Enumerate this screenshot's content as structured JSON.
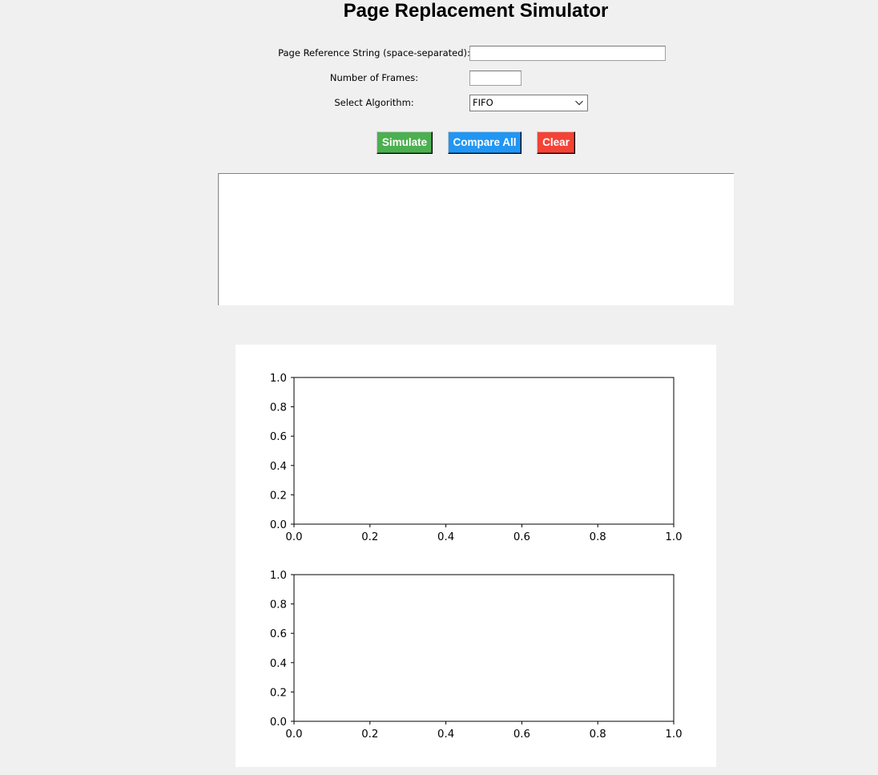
{
  "header": {
    "title": "Page Replacement Simulator"
  },
  "form": {
    "reference_label": "Page Reference String (space-separated):",
    "reference_value": "",
    "frames_label": "Number of Frames:",
    "frames_value": "",
    "algorithm_label": "Select Algorithm:",
    "algorithm_selected": "FIFO"
  },
  "buttons": {
    "simulate": {
      "label": "Simulate",
      "color": "#4caf50"
    },
    "compare": {
      "label": "Compare All",
      "color": "#2196f3"
    },
    "clear": {
      "label": "Clear",
      "color": "#f44336"
    }
  },
  "output": {
    "text": ""
  },
  "icons": {
    "combo_arrow": "chevron-down-icon"
  },
  "chart_data": [
    {
      "type": "line",
      "series": [],
      "title": "",
      "xlabel": "",
      "ylabel": "",
      "xlim": [
        0,
        1
      ],
      "ylim": [
        0,
        1
      ],
      "x_ticks": [
        0.0,
        0.2,
        0.4,
        0.6,
        0.8,
        1.0
      ],
      "y_ticks": [
        0.0,
        0.2,
        0.4,
        0.6,
        0.8,
        1.0
      ],
      "x_tick_labels": [
        "0.0",
        "0.2",
        "0.4",
        "0.6",
        "0.8",
        "1.0"
      ],
      "y_tick_labels": [
        "0.0",
        "0.2",
        "0.4",
        "0.6",
        "0.8",
        "1.0"
      ],
      "grid": false
    },
    {
      "type": "line",
      "series": [],
      "title": "",
      "xlabel": "",
      "ylabel": "",
      "xlim": [
        0,
        1
      ],
      "ylim": [
        0,
        1
      ],
      "x_ticks": [
        0.0,
        0.2,
        0.4,
        0.6,
        0.8,
        1.0
      ],
      "y_ticks": [
        0.0,
        0.2,
        0.4,
        0.6,
        0.8,
        1.0
      ],
      "x_tick_labels": [
        "0.0",
        "0.2",
        "0.4",
        "0.6",
        "0.8",
        "1.0"
      ],
      "y_tick_labels": [
        "0.0",
        "0.2",
        "0.4",
        "0.6",
        "0.8",
        "1.0"
      ],
      "grid": false
    }
  ]
}
